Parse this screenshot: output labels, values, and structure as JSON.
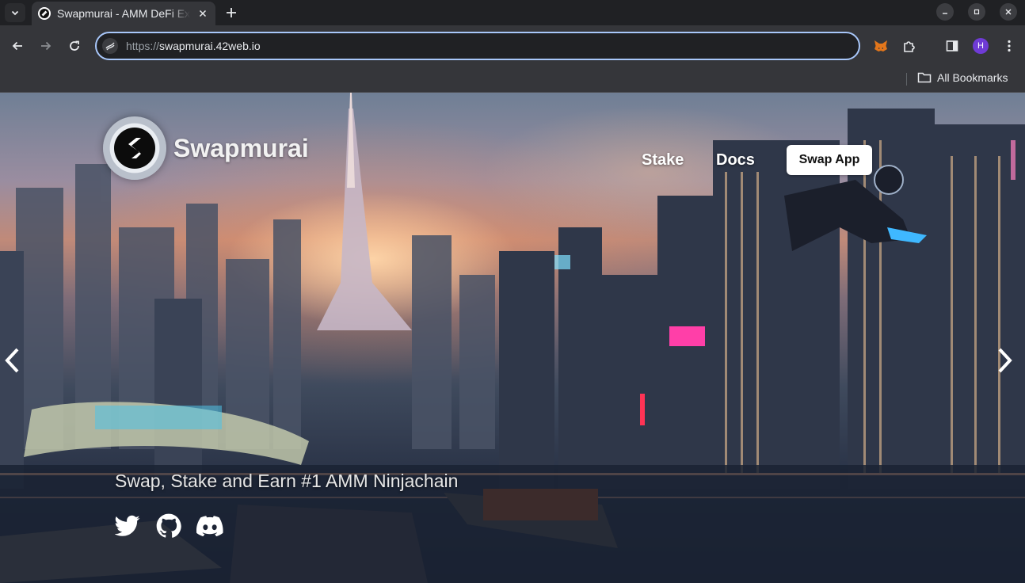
{
  "browser": {
    "tab_title": "Swapmurai - AMM DeFi Exchange",
    "url_protocol": "https://",
    "url_host": "swapmurai.42web.io",
    "profile_initial": "H",
    "bookmarks_label": "All Bookmarks",
    "icons": {
      "tab_search": "chevron-down-icon",
      "favicon": "swapmurai-favicon",
      "close": "close-icon",
      "new_tab": "plus-icon",
      "back": "arrow-left-icon",
      "forward": "arrow-right-icon",
      "reload": "reload-icon",
      "metamask": "fox-icon",
      "extensions": "puzzle-icon",
      "side_panel": "side-panel-icon",
      "menu": "kebab-menu-icon",
      "folder": "folder-icon"
    },
    "colors": {
      "omnibox_focus": "#a8c7fa",
      "avatar": "#6f3bd6"
    }
  },
  "site": {
    "brand": "Swapmurai",
    "nav": {
      "stake": "Stake",
      "docs": "Docs",
      "swap_app": "Swap App"
    },
    "tagline": "Swap, Stake and Earn #1 AMM Ninjachain",
    "social": [
      "twitter-icon",
      "github-icon",
      "discord-icon"
    ],
    "carousel": {
      "prev": "chevron-left-icon",
      "next": "chevron-right-icon"
    }
  }
}
